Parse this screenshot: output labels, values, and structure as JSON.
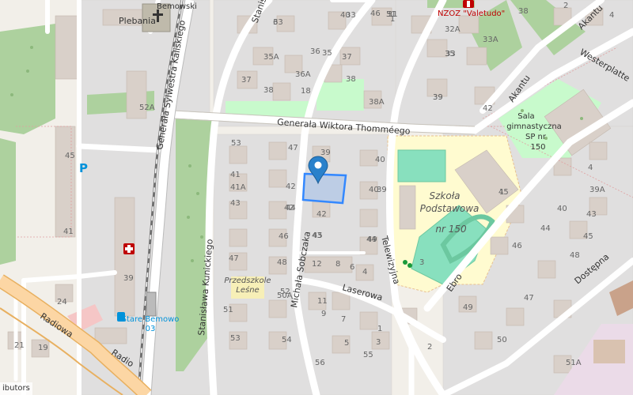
{
  "map": {
    "attribution": "ibutors",
    "streets": {
      "thommee": "Generała Wiktora Thomméego",
      "kaliski": "Generała Sylwestra Kaliskiego",
      "sobczaka": "Michała Sobczaka",
      "kunickiego": "Stanisława Kunickiego",
      "telewizyjna": "Telewizyjna",
      "laserowa": "Laserowa",
      "radiowa": "Radiowa",
      "radiowa_lower": "Radio",
      "westerplatte": "Westerplatte",
      "akantu_top": "Akantu",
      "akantu_mid": "Akantu",
      "ebro": "Ebro",
      "dostepna": "Dostępna",
      "stanislawa_top": "Stanisła"
    },
    "places": {
      "plebania": "Plebania",
      "bemowski": "Bemowski",
      "nzoz": "NZOZ \"Valetudo\"",
      "sala_line1": "Sala",
      "sala_line2": "gimnastyczna",
      "sala_line3": "SP nr",
      "sala_line4": "150",
      "szkola_line1": "Szkoła",
      "szkola_line2": "Podstawowa",
      "szkola_line3": "nr 150",
      "przedszkole_line1": "Przedszkole",
      "przedszkole_line2": "Leśne",
      "stare_bemowo": "Stare Bemowo",
      "station_num": "03",
      "parking": "P"
    },
    "house_numbers": [
      "31",
      "33",
      "33",
      "35",
      "36",
      "35A",
      "36A",
      "37",
      "38",
      "18",
      "37",
      "38",
      "39",
      "40",
      "38A",
      "39",
      "31",
      "32A",
      "33",
      "33A",
      "35",
      "42",
      "38",
      "39",
      "40",
      "41",
      "42",
      "41A",
      "43",
      "44",
      "45",
      "46",
      "47",
      "48",
      "49",
      "12",
      "8",
      "6",
      "4",
      "51",
      "52",
      "53",
      "54",
      "55",
      "50A",
      "56",
      "11",
      "9",
      "7",
      "5",
      "3",
      "1",
      "45",
      "41",
      "39",
      "24",
      "21",
      "19",
      "1",
      "2",
      "3",
      "4",
      "39A",
      "40",
      "43",
      "44",
      "45",
      "46",
      "47",
      "48",
      "49",
      "50",
      "51A",
      "52A",
      "53",
      "47",
      "39",
      "40",
      "42",
      "42",
      "43",
      "44",
      "45",
      "46",
      "1",
      "2",
      "4",
      "5",
      "6"
    ],
    "colors": {
      "background": "#f2efe9",
      "residential": "#e0dfdf",
      "building": "#d9d0c9",
      "park": "#c8facc",
      "forest": "#add19e",
      "school_area": "#fffbd0",
      "pitch": "#88e0be",
      "marker": "#2a81cb",
      "selection": "#3388ff",
      "road": "#ffffff",
      "primary_road": "#fcd6a4",
      "rail": "#707070"
    },
    "icons": [
      "church-icon",
      "parking-icon",
      "pharmacy-icon",
      "location-marker-icon",
      "bus-stop-icon",
      "playground-icon"
    ]
  }
}
